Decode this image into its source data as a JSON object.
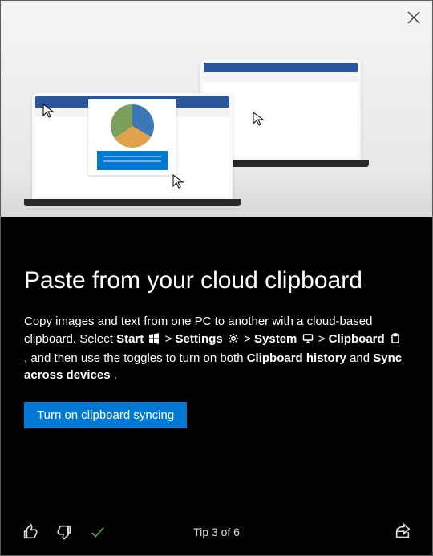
{
  "title": "Paste from your cloud clipboard",
  "description": {
    "pre": "Copy images and text from one PC to another with a cloud-based clipboard. Select ",
    "start": "Start",
    "sep": " > ",
    "settings": "Settings",
    "system": "System",
    "clipboard": "Clipboard",
    "mid": ", and then use the toggles to turn on both ",
    "history": "Clipboard history",
    "and": " and ",
    "sync": "Sync across devices",
    "end": "."
  },
  "cta_label": "Turn on clipboard syncing",
  "footer": {
    "progress": "Tip 3 of 6"
  },
  "icons": {
    "close": "close-icon",
    "windows": "windows-logo-icon",
    "gear": "gear-icon",
    "monitor": "monitor-icon",
    "clipboard": "clipboard-icon",
    "thumbs_up": "thumbs-up-icon",
    "thumbs_down": "thumbs-down-icon",
    "check": "checkmark-icon",
    "share": "share-icon",
    "cursor": "cursor-icon"
  }
}
